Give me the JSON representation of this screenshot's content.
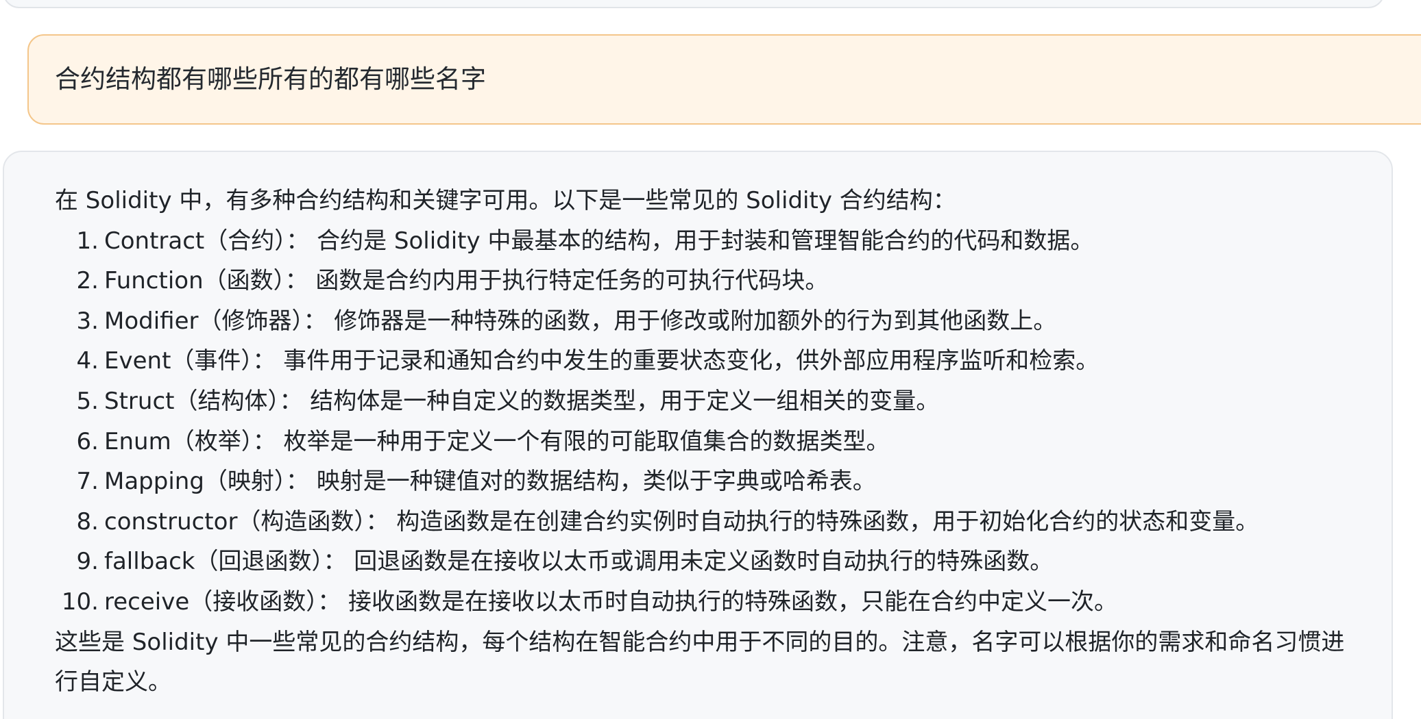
{
  "user_message": {
    "text": "合约结构都有哪些所有的都有哪些名字"
  },
  "assistant_message": {
    "intro": "在 Solidity 中，有多种合约结构和关键字可用。以下是一些常见的 Solidity 合约结构：",
    "items": [
      {
        "num": "1.",
        "text": "Contract（合约）： 合约是 Solidity 中最基本的结构，用于封装和管理智能合约的代码和数据。"
      },
      {
        "num": "2.",
        "text": "Function（函数）： 函数是合约内用于执行特定任务的可执行代码块。"
      },
      {
        "num": "3.",
        "text": "Modifier（修饰器）： 修饰器是一种特殊的函数，用于修改或附加额外的行为到其他函数上。"
      },
      {
        "num": "4.",
        "text": "Event（事件）： 事件用于记录和通知合约中发生的重要状态变化，供外部应用程序监听和检索。"
      },
      {
        "num": "5.",
        "text": "Struct（结构体）： 结构体是一种自定义的数据类型，用于定义一组相关的变量。"
      },
      {
        "num": "6.",
        "text": "Enum（枚举）： 枚举是一种用于定义一个有限的可能取值集合的数据类型。"
      },
      {
        "num": "7.",
        "text": "Mapping（映射）： 映射是一种键值对的数据结构，类似于字典或哈希表。"
      },
      {
        "num": "8.",
        "text": "constructor（构造函数）： 构造函数是在创建合约实例时自动执行的特殊函数，用于初始化合约的状态和变量。"
      },
      {
        "num": "9.",
        "text": "fallback（回退函数）： 回退函数是在接收以太币或调用未定义函数时自动执行的特殊函数。"
      },
      {
        "num": "10.",
        "text": "receive（接收函数）： 接收函数是在接收以太币时自动执行的特殊函数，只能在合约中定义一次。"
      }
    ],
    "closing": "这些是 Solidity 中一些常见的合约结构，每个结构在智能合约中用于不同的目的。注意，名字可以根据你的需求和命名习惯进行自定义。"
  },
  "colors": {
    "user_bubble_bg": "#fff5e8",
    "user_bubble_border": "#f4c68a",
    "assistant_bg": "#f7f8fa",
    "assistant_border": "#e3e6ea"
  }
}
